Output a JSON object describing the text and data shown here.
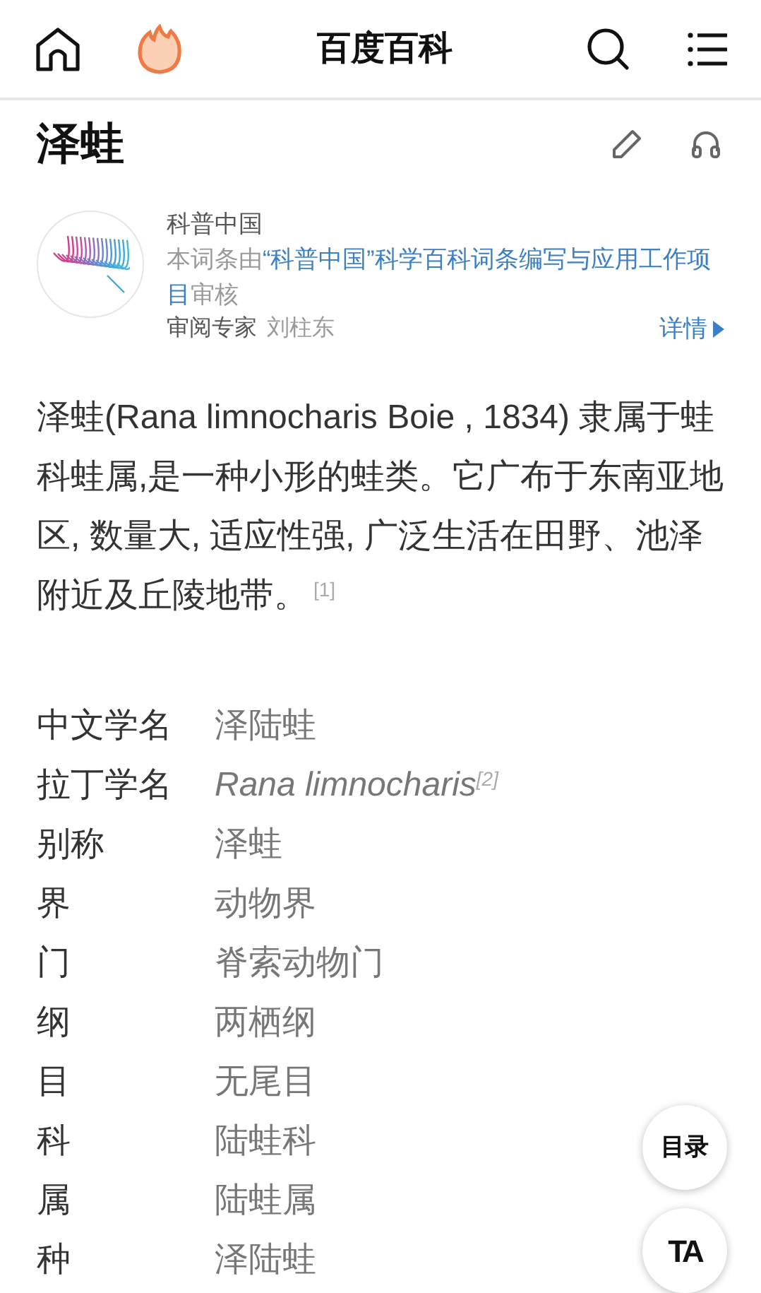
{
  "header": {
    "title": "百度百科"
  },
  "article": {
    "title": "泽蛙"
  },
  "source": {
    "name": "科普中国",
    "description": [
      {
        "text": "本词条由",
        "link": false
      },
      {
        "text": "“科普中国”科学百科词条编写与应用工作项目",
        "link": true
      },
      {
        "text": "审核",
        "link": false
      }
    ],
    "reviewer_label": "审阅专家",
    "reviewer": "刘柱东",
    "details": "详情"
  },
  "summary": "泽蛙(Rana limnocharis Boie , 1834) 隶属于蛙科蛙属,是一种小形的蛙类。它广布于东南亚地区, 数量大, 适应性强, 广泛生活在田野、池泽附近及丘陵地带。$^{[1]}$",
  "infobox": [
    {
      "label": "中文学名",
      "value": "泽陆蛙",
      "italic": false
    },
    {
      "label": "拉丁学名",
      "value": "Rana limnocharis$^{[2]}$",
      "italic": true
    },
    {
      "label": "别称",
      "value": "泽蛙",
      "italic": false
    },
    {
      "label": "界",
      "value": "动物界",
      "italic": false
    },
    {
      "label": "门",
      "value": "脊索动物门",
      "italic": false
    },
    {
      "label": "纲",
      "value": "两栖纲",
      "italic": false
    },
    {
      "label": "目",
      "value": "无尾目",
      "italic": false
    },
    {
      "label": "科",
      "value": "陆蛙科",
      "italic": false
    },
    {
      "label": "属",
      "value": "陆蛙属",
      "italic": false
    },
    {
      "label": "种",
      "value": "泽陆蛙",
      "italic": false
    }
  ],
  "floating_buttons": [
    "目录",
    "TA"
  ]
}
